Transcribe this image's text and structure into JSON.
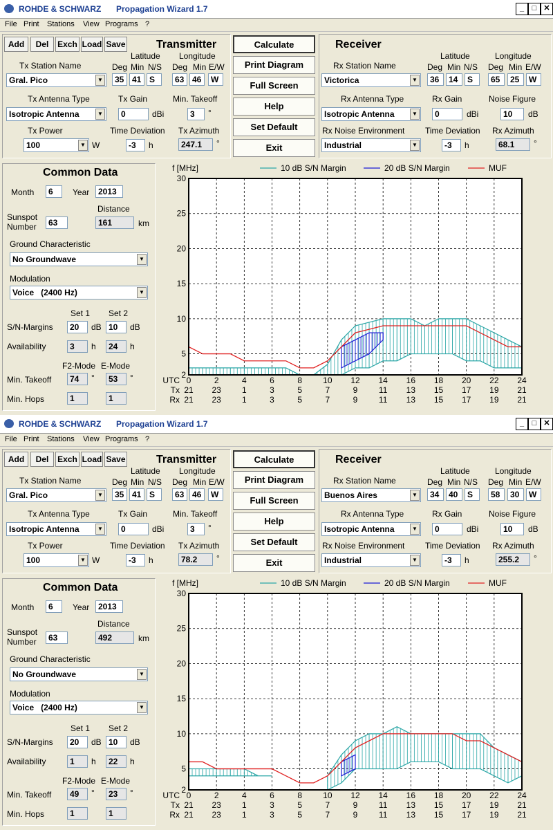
{
  "colors": {
    "band10": "#2aa6a6",
    "band20": "#1a1ad6",
    "muf": "#e02020",
    "title_text": "#1c3f92"
  },
  "windows": [
    {
      "brand": "ROHDE & SCHWARZ",
      "title": "Propagation Wizard  1.7",
      "menu": [
        "File",
        "Print",
        "Stations",
        "View",
        "Programs",
        "?"
      ],
      "station_buttons": [
        "Add",
        "Del",
        "Exch",
        "Load",
        "Save"
      ],
      "transmitter": {
        "heading": "Transmitter",
        "station_label": "Tx Station Name",
        "station": "Gral. Pico",
        "lat_label": "Latitude",
        "lon_label": "Longitude",
        "deg": "Deg",
        "min": "Min",
        "ns": "N/S",
        "ew": "E/W",
        "lat_deg": "35",
        "lat_min": "41",
        "lat_ns": "S",
        "lon_deg": "63",
        "lon_min": "46",
        "lon_ew": "W",
        "antenna_label": "Tx Antenna Type",
        "antenna": "Isotropic Antenna",
        "gain_label": "Tx Gain",
        "gain": "0",
        "gain_unit": "dBi",
        "takeoff_label": "Min. Takeoff",
        "takeoff": "3",
        "deg_unit": "°",
        "power_label": "Tx Power",
        "power": "100",
        "power_unit": "W",
        "timedev_label": "Time Deviation",
        "timedev": "-3",
        "h_unit": "h",
        "azimuth_label": "Tx Azimuth",
        "azimuth": "247.1"
      },
      "actions": [
        "Calculate",
        "Print Diagram",
        "Full Screen",
        "Help",
        "Set Default",
        "Exit"
      ],
      "receiver": {
        "heading": "Receiver",
        "station_label": "Rx Station Name",
        "station": "Victorica",
        "lat_label": "Latitude",
        "lon_label": "Longitude",
        "deg": "Deg",
        "min": "Min",
        "ns": "N/S",
        "ew": "E/W",
        "lat_deg": "36",
        "lat_min": "14",
        "lat_ns": "S",
        "lon_deg": "65",
        "lon_min": "25",
        "lon_ew": "W",
        "antenna_label": "Rx Antenna Type",
        "antenna": "Isotropic Antenna",
        "gain_label": "Rx Gain",
        "gain": "0",
        "gain_unit": "dBi",
        "noise_label": "Noise Figure",
        "noise": "10",
        "noise_unit": "dB",
        "env_label": "Rx Noise Environment",
        "env": "Industrial",
        "timedev_label": "Time Deviation",
        "timedev": "-3",
        "h_unit": "h",
        "azimuth_label": "Rx Azimuth",
        "azimuth": "68.1",
        "deg_unit": "°"
      },
      "common": {
        "heading": "Common Data",
        "month_label": "Month",
        "month": "6",
        "year_label": "Year",
        "year": "2013",
        "sunspot_label_1": "Sunspot",
        "sunspot_label_2": "Number",
        "sunspot": "63",
        "distance_label": "Distance",
        "distance": "161",
        "km_unit": "km",
        "ground_label": "Ground Characteristic",
        "ground": "No Groundwave",
        "modulation_label": "Modulation",
        "modulation": "Voice   (2400 Hz)",
        "set1_label": "Set 1",
        "set2_label": "Set 2",
        "sn_label": "S/N-Margins",
        "sn1": "20",
        "sn2": "10",
        "db_unit": "dB",
        "avail_label": "Availability",
        "avail1": "3",
        "avail2": "24",
        "h_unit": "h",
        "f2_label": "F2-Mode",
        "e_label": "E-Mode",
        "takeoff_label": "Min. Takeoff",
        "takeoff_f2": "74",
        "takeoff_e": "53",
        "deg_unit": "°",
        "hops_label": "Min. Hops",
        "hops_f2": "1",
        "hops_e": "1"
      },
      "chart_data": {
        "type": "area",
        "ylabel": "f [MHz]",
        "ylim": [
          2,
          30
        ],
        "yticks": [
          2,
          5,
          10,
          15,
          20,
          25,
          30
        ],
        "row_labels": [
          "UTC",
          "Tx",
          "Rx"
        ],
        "utc_ticks": [
          "0",
          "2",
          "4",
          "6",
          "8",
          "10",
          "12",
          "14",
          "16",
          "18",
          "20",
          "22",
          "24"
        ],
        "tx_ticks": [
          "21",
          "23",
          "1",
          "3",
          "5",
          "7",
          "9",
          "11",
          "13",
          "15",
          "17",
          "19",
          "21"
        ],
        "rx_ticks": [
          "21",
          "23",
          "1",
          "3",
          "5",
          "7",
          "9",
          "11",
          "13",
          "15",
          "17",
          "19",
          "21"
        ],
        "legend": [
          "10 dB S/N Margin",
          "20 dB S/N Margin",
          "MUF"
        ],
        "grid": true,
        "x": [
          0,
          1,
          2,
          3,
          4,
          5,
          6,
          7,
          8,
          9,
          10,
          11,
          12,
          13,
          14,
          15,
          16,
          17,
          18,
          19,
          20,
          21,
          22,
          23,
          24
        ],
        "series": [
          {
            "name": "10 dB S/N Margin",
            "kind": "band",
            "upper": [
              3,
              3,
              3,
              3,
              3,
              3,
              3,
              3,
              2,
              2,
              3.5,
              7,
              9,
              9.5,
              10,
              10,
              10,
              9,
              10,
              10,
              10,
              9,
              8,
              7,
              6
            ],
            "lower": [
              2,
              2,
              2,
              2,
              2,
              2,
              2,
              2,
              2,
              2,
              2,
              2,
              3,
              3,
              4,
              4,
              5,
              5,
              5,
              5,
              4,
              4,
              3,
              3,
              3
            ]
          },
          {
            "name": "20 dB S/N Margin",
            "kind": "band",
            "upper": [
              null,
              null,
              null,
              null,
              null,
              null,
              null,
              null,
              null,
              null,
              null,
              6,
              7,
              8,
              8,
              null,
              null,
              null,
              null,
              null,
              null,
              null,
              null,
              null,
              null
            ],
            "lower": [
              null,
              null,
              null,
              null,
              null,
              null,
              null,
              null,
              null,
              null,
              null,
              3,
              4,
              5,
              7,
              null,
              null,
              null,
              null,
              null,
              null,
              null,
              null,
              null,
              null
            ]
          },
          {
            "name": "MUF",
            "kind": "line",
            "values": [
              6,
              5,
              5,
              5,
              4,
              4,
              4,
              4,
              3,
              3,
              4,
              6,
              8,
              8.5,
              9,
              9,
              9,
              9,
              9,
              9,
              9,
              8,
              7,
              6,
              6
            ]
          }
        ]
      }
    },
    {
      "brand": "ROHDE & SCHWARZ",
      "title": "Propagation Wizard  1.7",
      "menu": [
        "File",
        "Print",
        "Stations",
        "View",
        "Programs",
        "?"
      ],
      "station_buttons": [
        "Add",
        "Del",
        "Exch",
        "Load",
        "Save"
      ],
      "transmitter": {
        "heading": "Transmitter",
        "station_label": "Tx Station Name",
        "station": "Gral. Pico",
        "lat_label": "Latitude",
        "lon_label": "Longitude",
        "deg": "Deg",
        "min": "Min",
        "ns": "N/S",
        "ew": "E/W",
        "lat_deg": "35",
        "lat_min": "41",
        "lat_ns": "S",
        "lon_deg": "63",
        "lon_min": "46",
        "lon_ew": "W",
        "antenna_label": "Tx Antenna Type",
        "antenna": "Isotropic Antenna",
        "gain_label": "Tx Gain",
        "gain": "0",
        "gain_unit": "dBi",
        "takeoff_label": "Min. Takeoff",
        "takeoff": "3",
        "deg_unit": "°",
        "power_label": "Tx Power",
        "power": "100",
        "power_unit": "W",
        "timedev_label": "Time Deviation",
        "timedev": "-3",
        "h_unit": "h",
        "azimuth_label": "Tx Azimuth",
        "azimuth": "78.2"
      },
      "actions": [
        "Calculate",
        "Print Diagram",
        "Full Screen",
        "Help",
        "Set Default",
        "Exit"
      ],
      "receiver": {
        "heading": "Receiver",
        "station_label": "Rx Station Name",
        "station": "Buenos Aires",
        "lat_label": "Latitude",
        "lon_label": "Longitude",
        "deg": "Deg",
        "min": "Min",
        "ns": "N/S",
        "ew": "E/W",
        "lat_deg": "34",
        "lat_min": "40",
        "lat_ns": "S",
        "lon_deg": "58",
        "lon_min": "30",
        "lon_ew": "W",
        "antenna_label": "Rx Antenna Type",
        "antenna": "Isotropic Antenna",
        "gain_label": "Rx Gain",
        "gain": "0",
        "gain_unit": "dBi",
        "noise_label": "Noise Figure",
        "noise": "10",
        "noise_unit": "dB",
        "env_label": "Rx Noise Environment",
        "env": "Industrial",
        "timedev_label": "Time Deviation",
        "timedev": "-3",
        "h_unit": "h",
        "azimuth_label": "Rx Azimuth",
        "azimuth": "255.2",
        "deg_unit": "°"
      },
      "common": {
        "heading": "Common Data",
        "month_label": "Month",
        "month": "6",
        "year_label": "Year",
        "year": "2013",
        "sunspot_label_1": "Sunspot",
        "sunspot_label_2": "Number",
        "sunspot": "63",
        "distance_label": "Distance",
        "distance": "492",
        "km_unit": "km",
        "ground_label": "Ground Characteristic",
        "ground": "No Groundwave",
        "modulation_label": "Modulation",
        "modulation": "Voice   (2400 Hz)",
        "set1_label": "Set 1",
        "set2_label": "Set 2",
        "sn_label": "S/N-Margins",
        "sn1": "20",
        "sn2": "10",
        "db_unit": "dB",
        "avail_label": "Availability",
        "avail1": "1",
        "avail2": "22",
        "h_unit": "h",
        "f2_label": "F2-Mode",
        "e_label": "E-Mode",
        "takeoff_label": "Min. Takeoff",
        "takeoff_f2": "49",
        "takeoff_e": "23",
        "deg_unit": "°",
        "hops_label": "Min. Hops",
        "hops_f2": "1",
        "hops_e": "1"
      },
      "chart_data": {
        "type": "area",
        "ylabel": "f [MHz]",
        "ylim": [
          2,
          30
        ],
        "yticks": [
          2,
          5,
          10,
          15,
          20,
          25,
          30
        ],
        "row_labels": [
          "UTC",
          "Tx",
          "Rx"
        ],
        "utc_ticks": [
          "0",
          "2",
          "4",
          "6",
          "8",
          "10",
          "12",
          "14",
          "16",
          "18",
          "20",
          "22",
          "24"
        ],
        "tx_ticks": [
          "21",
          "23",
          "1",
          "3",
          "5",
          "7",
          "9",
          "11",
          "13",
          "15",
          "17",
          "19",
          "21"
        ],
        "rx_ticks": [
          "21",
          "23",
          "1",
          "3",
          "5",
          "7",
          "9",
          "11",
          "13",
          "15",
          "17",
          "19",
          "21"
        ],
        "legend": [
          "10 dB S/N Margin",
          "20 dB S/N Margin",
          "MUF"
        ],
        "grid": true,
        "x": [
          0,
          1,
          2,
          3,
          4,
          5,
          6,
          7,
          8,
          9,
          10,
          11,
          12,
          13,
          14,
          15,
          16,
          17,
          18,
          19,
          20,
          21,
          22,
          23,
          24
        ],
        "series": [
          {
            "name": "10 dB S/N Margin",
            "kind": "band",
            "upper": [
              5,
              5,
              5,
              5,
              5,
              4,
              4,
              null,
              null,
              null,
              4,
              7,
              9,
              10,
              10,
              11,
              10,
              10,
              10,
              10,
              10,
              10,
              8,
              7,
              6
            ],
            "lower": [
              4,
              4,
              4,
              4,
              4,
              4,
              4,
              null,
              null,
              null,
              2,
              3,
              5,
              5,
              5,
              5,
              6,
              6,
              6,
              5,
              5,
              5,
              4,
              3,
              4
            ]
          },
          {
            "name": "20 dB S/N Margin",
            "kind": "band",
            "upper": [
              null,
              null,
              null,
              null,
              null,
              null,
              null,
              null,
              null,
              null,
              null,
              6,
              7,
              null,
              null,
              null,
              null,
              null,
              null,
              null,
              null,
              null,
              null,
              null,
              null
            ],
            "lower": [
              null,
              null,
              null,
              null,
              null,
              null,
              null,
              null,
              null,
              null,
              null,
              4,
              5,
              null,
              null,
              null,
              null,
              null,
              null,
              null,
              null,
              null,
              null,
              null,
              null
            ]
          },
          {
            "name": "MUF",
            "kind": "line",
            "values": [
              6,
              6,
              5,
              5,
              5,
              5,
              5,
              4,
              3,
              3,
              4,
              6,
              8,
              9,
              10,
              10,
              10,
              10,
              10,
              10,
              9,
              9,
              8,
              7,
              6
            ]
          }
        ]
      }
    }
  ]
}
